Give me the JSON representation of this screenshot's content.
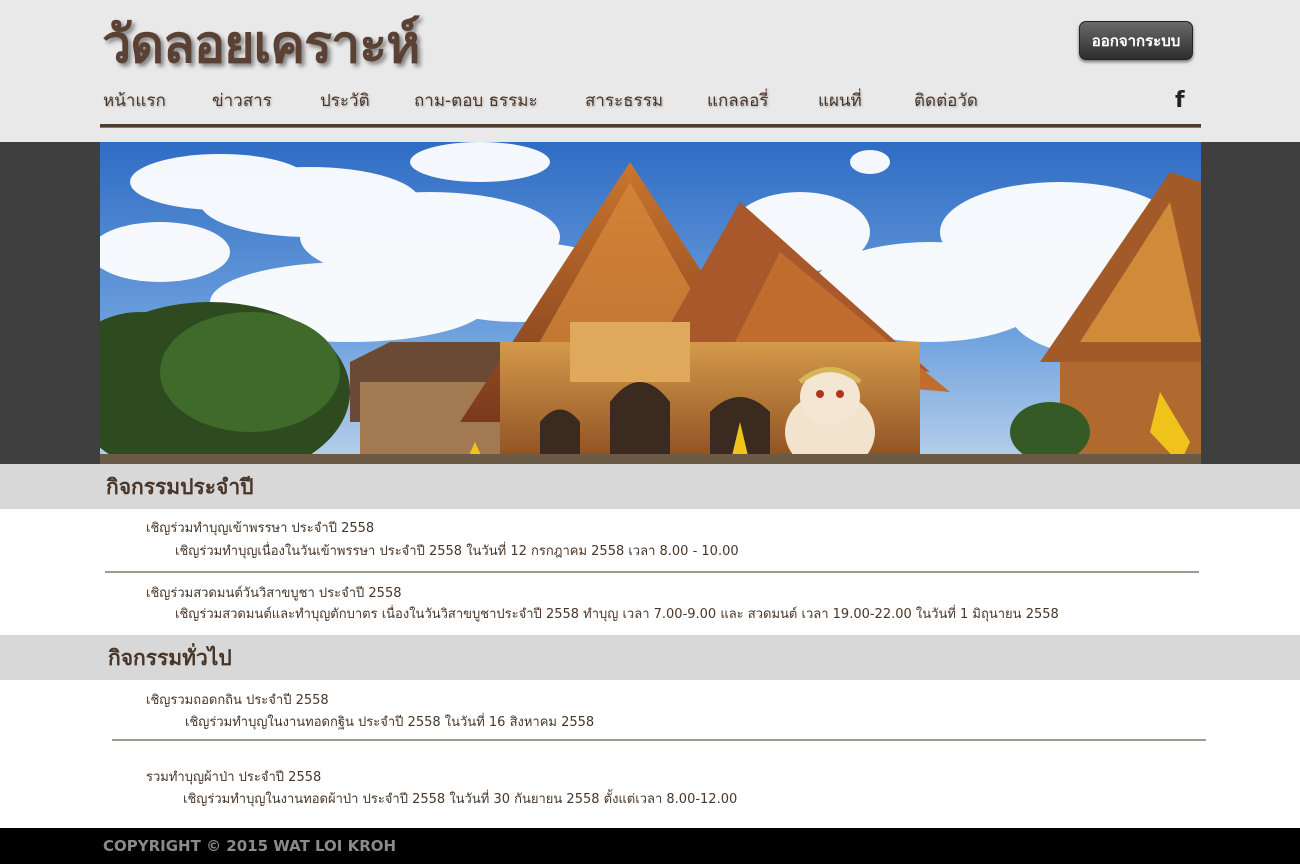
{
  "header": {
    "site_title": "วัดลอยเคราะห์",
    "logout_label": "ออกจากระบบ",
    "facebook_icon": "facebook-icon"
  },
  "nav": {
    "items": [
      {
        "label": "หน้าแรก"
      },
      {
        "label": "ข่าวสาร"
      },
      {
        "label": "ประวัติ"
      },
      {
        "label": "ถาม-ตอบ ธรรมะ"
      },
      {
        "label": "สาระธรรม"
      },
      {
        "label": "แกลลอรี่"
      },
      {
        "label": "แผนที่"
      },
      {
        "label": "ติดต่อวัด"
      }
    ]
  },
  "banner": {
    "alt": "temple-banner"
  },
  "annual": {
    "title": "กิจกรรมประจำปี",
    "items": [
      {
        "title": "เชิญร่วมทำบุญเข้าพรรษา ประจำปี 2558",
        "desc": "เชิญร่วมทำบุญเนื่องในวันเข้าพรรษา ประจำปี 2558 ในวันที่ 12 กรกฎาคม 2558 เวลา 8.00 - 10.00"
      },
      {
        "title": "เชิญร่วมสวดมนต์วันวิสาขบูชา ประจำปี 2558",
        "desc": "เชิญร่วมสวดมนต์และทำบุญตักบาตร เนื่องในวันวิสาขบูชาประจำปี 2558 ทำบุญ เวลา 7.00-9.00  และ สวดมนต์ เวลา 19.00-22.00 ในวันที่ 1 มิถุนายน 2558"
      }
    ]
  },
  "general": {
    "title": "กิจกรรมทั่วไป",
    "items": [
      {
        "title": "เชิญรวมถอดกถิน ประจำปี 2558",
        "desc": "เชิญร่วมทำบุญในงานทอดกฐิน ประจำปี 2558 ในวันที่ 16 สิงหาคม 2558"
      },
      {
        "title": "รวมทำบุญผ้าป่า ประจำปี 2558",
        "desc": "เชิญร่วมทำบุญในงานทอดผ้าป่า ประจำปี  2558  ในวันที่ 30 กันยายน 2558 ตั้งแต่เวลา 8.00-12.00"
      }
    ]
  },
  "footer": {
    "copyright": "COPYRIGHT © 2015 WAT LOI KROH"
  },
  "colors": {
    "brand_brown": "#4a3628",
    "header_bg": "#e9e9e9",
    "section_bar": "#d8d8d8",
    "footer_bg": "#000000"
  }
}
